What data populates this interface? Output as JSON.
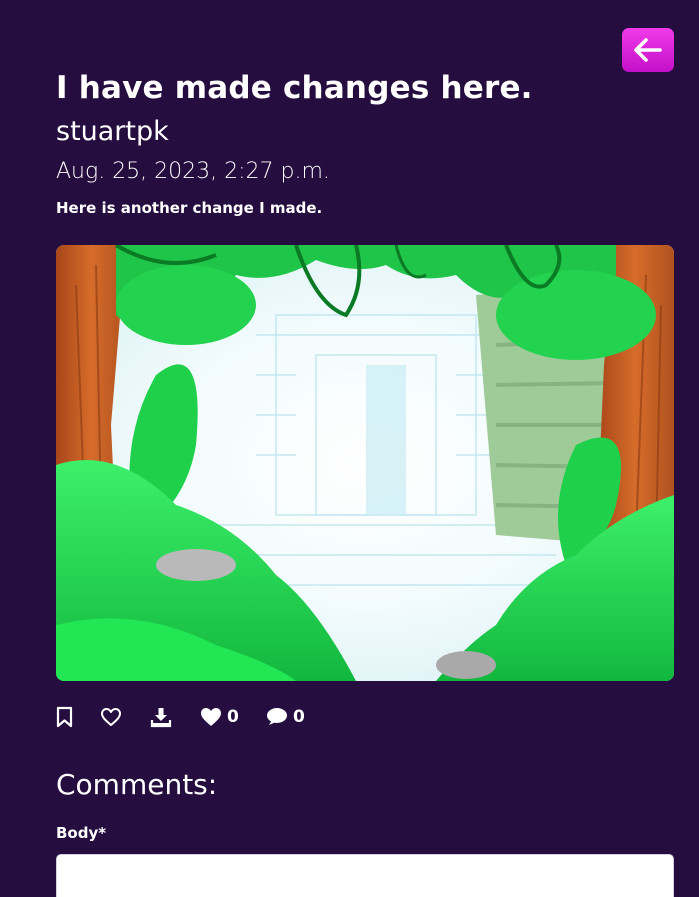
{
  "post": {
    "title": "I have made changes here.",
    "author": "stuartpk",
    "date": "Aug. 25, 2023, 2:27 p.m.",
    "description": "Here is another change I made."
  },
  "back_button": {
    "icon": "arrow-left-icon",
    "accent_color": "#e222e0"
  },
  "actions": {
    "bookmark_icon": "bookmark-icon",
    "favorite_icon": "heart-outline-icon",
    "download_icon": "download-icon",
    "likes_icon": "heart-filled-icon",
    "likes_count": "0",
    "comments_icon": "comment-icon",
    "comments_count": "0"
  },
  "comments": {
    "heading": "Comments:",
    "body_label": "Body*",
    "body_value": ""
  },
  "colors": {
    "background": "#260d3f",
    "text": "#ffffff"
  }
}
